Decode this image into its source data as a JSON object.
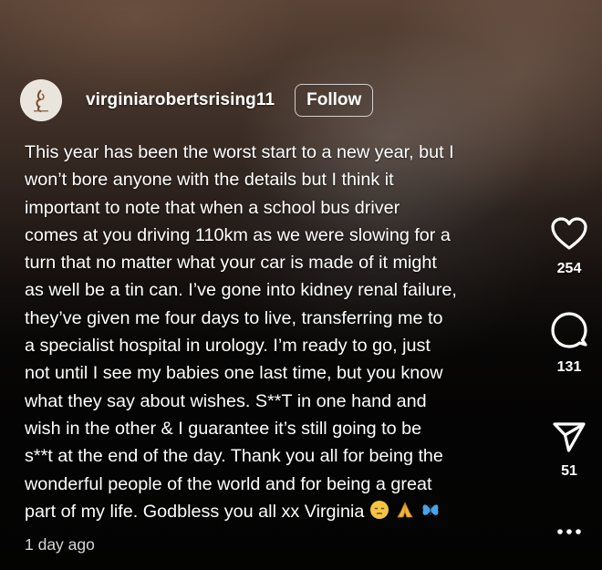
{
  "post": {
    "username": "virginiarobertsrising11",
    "follow_label": "Follow",
    "caption_lines": [
      "This year has been the worst start to a new year, but I",
      "won’t bore anyone with the details but I think it",
      "important to note that when a school bus driver",
      "comes at you driving 110km as we were slowing for a",
      "turn that no matter what your car is made of it might",
      "as well be a tin can. I’ve gone into kidney renal failure,",
      "they’ve given me four days to live, transferring me to",
      "a specialist hospital in urology. I’m ready to go, just",
      "not until I see my babies one last time, but you know",
      "what they say about wishes. S**T in one hand and",
      "wish in the other & I guarantee it’s still going to be",
      "s**t at the end of the day. Thank you all for being the",
      "wonderful people of the world and for being a great",
      "part of my life. Godbless you all xx Virginia"
    ],
    "caption_emojis": [
      "pensive-face",
      "folded-hands",
      "butterfly"
    ],
    "timestamp": "1 day ago"
  },
  "actions": {
    "like": {
      "icon": "heart-icon",
      "count": "254"
    },
    "comment": {
      "icon": "comment-icon",
      "count": "131"
    },
    "share": {
      "icon": "send-icon",
      "count": "51"
    },
    "more": {
      "icon": "more-icon"
    }
  },
  "colors": {
    "text": "#ffffff",
    "timestamp": "#d6d6d6",
    "butterfly": "#4aa3e8",
    "emoji_face": "#f5c542"
  }
}
